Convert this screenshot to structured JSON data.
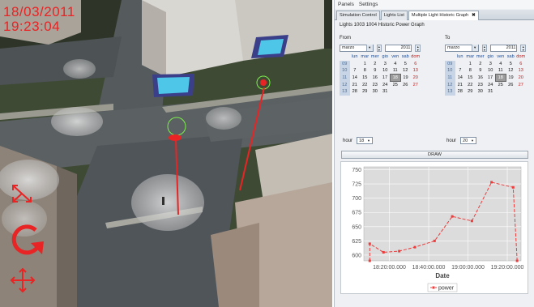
{
  "overlay": {
    "date": "18/03/2011",
    "time": "19:23:04"
  },
  "menubar": {
    "items": [
      "Panels",
      "Settings"
    ]
  },
  "tabs": [
    {
      "label": "Simulation Control",
      "active": false
    },
    {
      "label": "Lights List",
      "active": false
    },
    {
      "label": "Multiple Light Historic Graph",
      "active": true,
      "closable": true
    }
  ],
  "header": "Lights  1003  1004 Historic Power Graph",
  "from": {
    "label": "From",
    "month": "marzo",
    "year": "2011",
    "selected_day": "18",
    "hour_label": "hour",
    "hour": "18"
  },
  "to": {
    "label": "To",
    "month": "marzo",
    "year": "2011",
    "selected_day": "18",
    "hour_label": "hour",
    "hour": "20"
  },
  "calendar": {
    "day_headers": [
      "lun",
      "mar",
      "mer",
      "gio",
      "ven",
      "sab",
      "dom"
    ],
    "weeks": [
      {
        "wk": "09",
        "days": [
          "",
          "1",
          "2",
          "3",
          "4",
          "5",
          "6"
        ]
      },
      {
        "wk": "10",
        "days": [
          "7",
          "8",
          "9",
          "10",
          "11",
          "12",
          "13"
        ]
      },
      {
        "wk": "11",
        "days": [
          "14",
          "15",
          "16",
          "17",
          "18",
          "19",
          "20"
        ]
      },
      {
        "wk": "12",
        "days": [
          "21",
          "22",
          "23",
          "24",
          "25",
          "26",
          "27"
        ]
      },
      {
        "wk": "13",
        "days": [
          "28",
          "29",
          "30",
          "31",
          "",
          "",
          ""
        ]
      }
    ]
  },
  "draw_button": "DRAW",
  "chart_data": {
    "type": "line",
    "xlabel": "Date",
    "ylabel": "",
    "ylim": [
      590,
      755
    ],
    "yticks": [
      600,
      625,
      650,
      675,
      700,
      725,
      750
    ],
    "xlim": [
      "18:07",
      "19:27"
    ],
    "xticks": [
      {
        "label": "18:20:00.000",
        "t": "18:20"
      },
      {
        "label": "18:40:00.000",
        "t": "18:40"
      },
      {
        "label": "19:00:00.000",
        "t": "19:00"
      },
      {
        "label": "19:20:00.000",
        "t": "19:20"
      }
    ],
    "series": [
      {
        "name": "power",
        "color": "#ee3b3b",
        "x": [
          "18:10",
          "18:10",
          "18:17",
          "18:25",
          "18:33",
          "18:43",
          "18:52",
          "19:02",
          "19:12",
          "19:23",
          "19:25"
        ],
        "y": [
          590,
          620,
          605,
          607,
          614,
          625,
          668,
          660,
          728,
          719,
          590
        ]
      }
    ],
    "legend": "bottom",
    "grid": true
  },
  "colors": {
    "accent_red": "#e82424",
    "series_red": "#ee3b3b",
    "building_glow": "#4ec6e8"
  },
  "icons": {
    "scale": "expand-arrows-icon",
    "rotate": "rotate-arrow-icon",
    "move": "move-arrows-icon"
  }
}
